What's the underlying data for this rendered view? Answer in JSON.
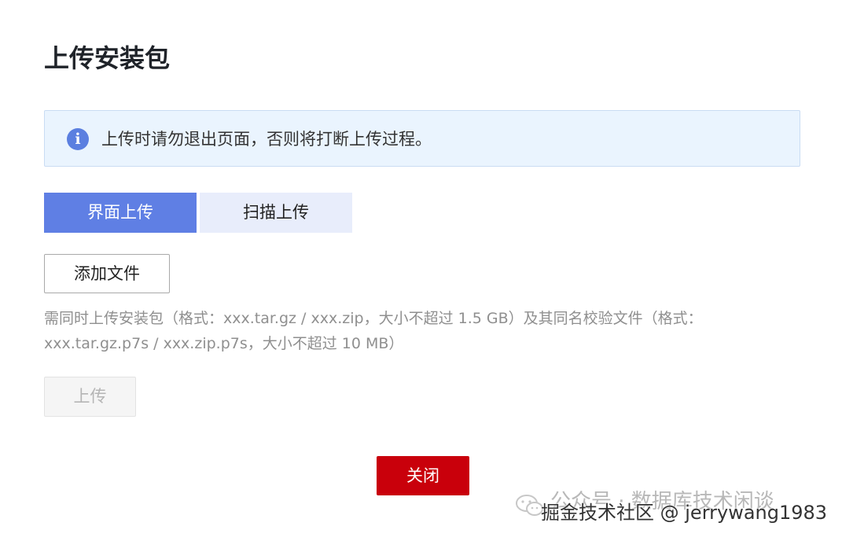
{
  "page": {
    "title": "上传安装包"
  },
  "notice": {
    "icon": "info-icon",
    "icon_glyph": "i",
    "text": "上传时请勿退出页面，否则将打断上传过程。",
    "accent_color": "#5b7fe0"
  },
  "tabs": [
    {
      "label": "界面上传",
      "active": true
    },
    {
      "label": "扫描上传",
      "active": false
    }
  ],
  "add_file_button": {
    "label": "添加文件"
  },
  "hint": {
    "text": "需同时上传安装包（格式：xxx.tar.gz / xxx.zip，大小不超过 1.5 GB）及其同名校验文件（格式：xxx.tar.gz.p7s / xxx.zip.p7s，大小不超过 10 MB）"
  },
  "upload_button": {
    "label": "上传",
    "disabled": true
  },
  "close_button": {
    "label": "关闭",
    "color": "#c9000b"
  },
  "watermark": {
    "icon": "wechat-icon",
    "line1": "公众号 · 数据库技术闲谈",
    "line2": "掘金技术社区 @ jerrywang1983"
  },
  "colors": {
    "tab_active": "#5f7fe4",
    "tab_inactive": "#e8edfb",
    "notice_bg": "#eaf4fe"
  }
}
